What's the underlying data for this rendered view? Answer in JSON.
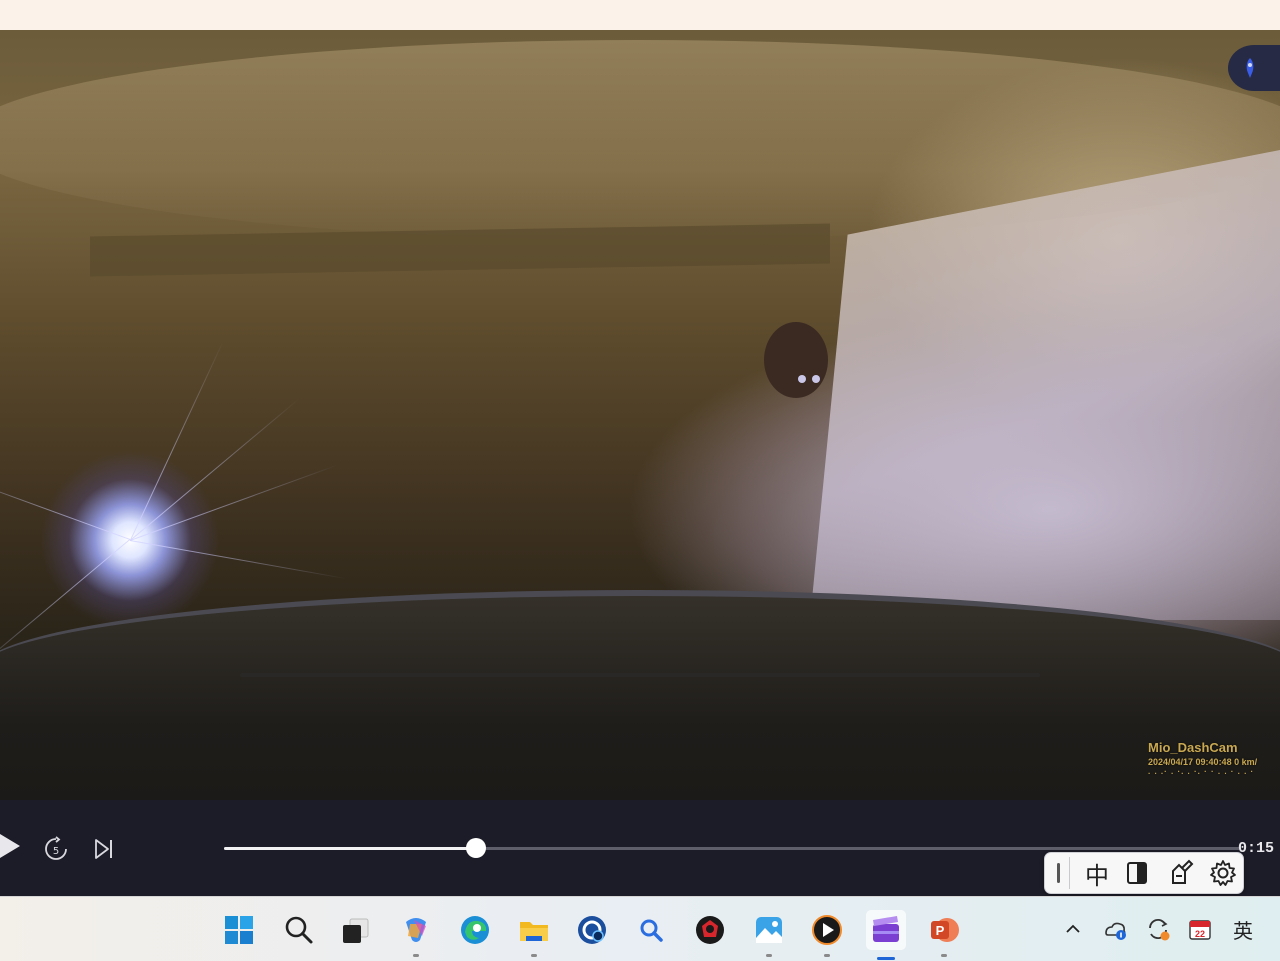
{
  "video": {
    "overlay": {
      "title": "Mio_DashCam",
      "timestamp_speed": "2024/04/17 09:40:48  0 km/",
      "dots": ". . .·  . ·. . ·. · ·  . . ·  . . ·"
    }
  },
  "controls": {
    "time": "0:15",
    "progress": 0.248,
    "icons": [
      "play-icon",
      "skip-forward-5-icon",
      "next-track-icon"
    ],
    "skip_label": "5"
  },
  "ime": {
    "mode_label": "中",
    "icons": [
      "ime-grip-icon",
      "half-full-width-icon",
      "ime-toolkit-icon",
      "gear-icon"
    ]
  },
  "taskbar": {
    "apps": [
      {
        "name": "windows-start-icon",
        "active": false,
        "running": false
      },
      {
        "name": "search-icon",
        "active": false,
        "running": false
      },
      {
        "name": "task-view-icon",
        "active": false,
        "running": false
      },
      {
        "name": "copilot-icon",
        "active": false,
        "running": true
      },
      {
        "name": "edge-icon",
        "active": false,
        "running": false
      },
      {
        "name": "file-explorer-icon",
        "active": false,
        "running": true
      },
      {
        "name": "cortana-icon",
        "active": false,
        "running": false
      },
      {
        "name": "everything-search-icon",
        "active": false,
        "running": false
      },
      {
        "name": "red-app-icon",
        "active": false,
        "running": false
      },
      {
        "name": "photos-icon",
        "active": false,
        "running": true
      },
      {
        "name": "media-player-icon",
        "active": false,
        "running": true
      },
      {
        "name": "clipchamp-icon",
        "active": true,
        "running": true
      },
      {
        "name": "powerpoint-icon",
        "active": false,
        "running": true
      }
    ],
    "tray": {
      "chevron": "^",
      "lang": "英",
      "calendar_day": "22"
    },
    "colors": {
      "accent": "#1e66d8",
      "edge": "#1a8fd6",
      "explorer": "#f3b921",
      "powerpoint": "#d24726",
      "clipchamp": "#7b3fd1"
    }
  }
}
